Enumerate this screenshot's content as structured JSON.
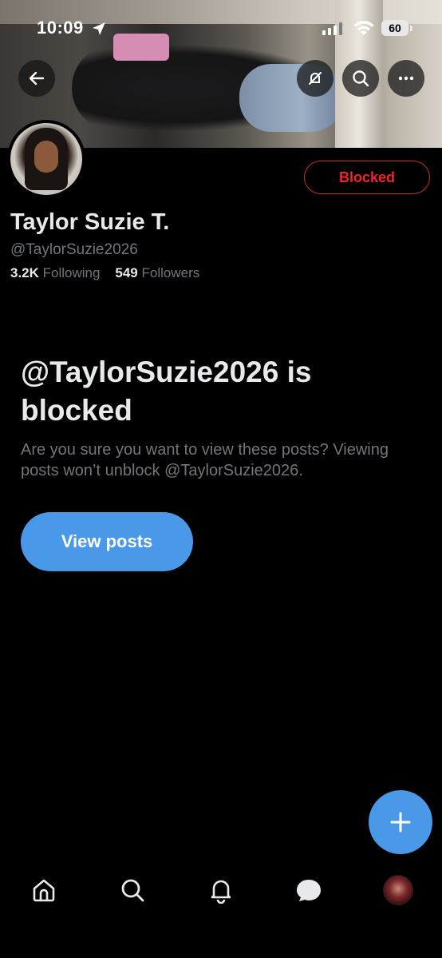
{
  "status_bar": {
    "time": "10:09",
    "battery": "60"
  },
  "header": {
    "buttons": [
      "back",
      "notifications-off",
      "search",
      "more"
    ]
  },
  "profile": {
    "name": "Taylor Suzie T.",
    "handle": "@TaylorSuzie2026",
    "following_count": "3.2K",
    "following_label": "Following",
    "followers_count": "549",
    "followers_label": "Followers",
    "blocked_label": "Blocked"
  },
  "blocked_notice": {
    "title": "@TaylorSuzie2026 is blocked",
    "description": "Are you sure you want to view these posts? Viewing posts won’t unblock @TaylorSuzie2026.",
    "button_label": "View posts"
  },
  "icons": {
    "back": "arrow-left-icon",
    "notifications_off": "bell-off-icon",
    "search": "search-icon",
    "more": "more-icon",
    "compose": "plus-icon",
    "nav": [
      "home-icon",
      "search-icon",
      "bell-icon",
      "messages-icon",
      "avatar"
    ]
  },
  "colors": {
    "background": "#000000",
    "accent": "#4a99e9",
    "blocked": "#f4212e",
    "secondary_text": "#71767b",
    "primary_text": "#e7e9ea"
  }
}
